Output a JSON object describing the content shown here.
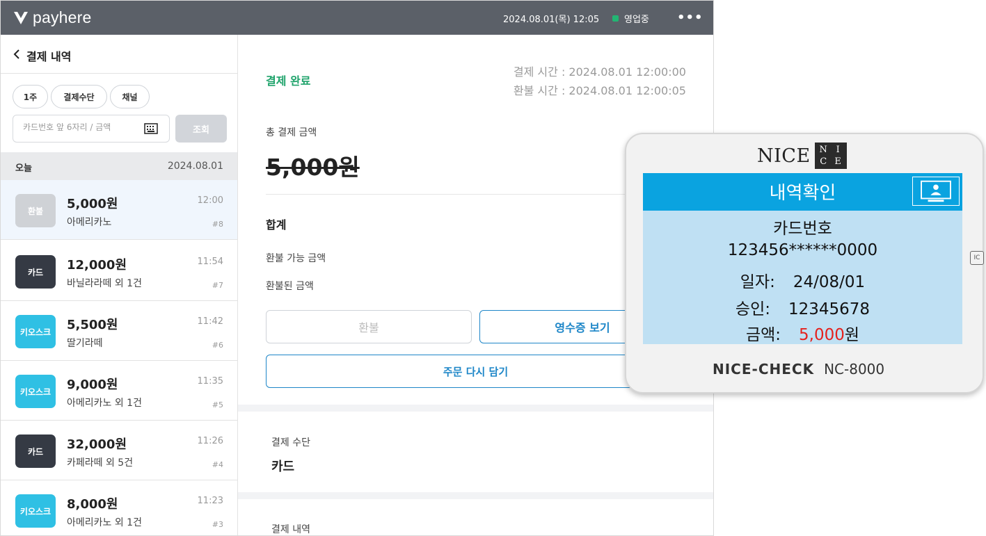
{
  "header": {
    "brand": "payhere",
    "datetime": "2024.08.01(목) 12:05",
    "store_status": "영업중"
  },
  "sidebar": {
    "title": "결제 내역",
    "filters": [
      "1주",
      "결제수단",
      "채널"
    ],
    "search": {
      "placeholder": "카드번호 앞 6자리 / 금액",
      "button": "조회"
    },
    "date_group": {
      "label": "오늘",
      "date": "2024.08.01"
    },
    "transactions": [
      {
        "badge": "환불",
        "amount": "5,000원",
        "item": "아메리카노",
        "time": "12:00",
        "no": "#8"
      },
      {
        "badge": "카드",
        "amount": "12,000원",
        "item": "바닐라라떼 외 1건",
        "time": "11:54",
        "no": "#7"
      },
      {
        "badge": "키오스크",
        "amount": "5,500원",
        "item": "딸기라떼",
        "time": "11:42",
        "no": "#6"
      },
      {
        "badge": "키오스크",
        "amount": "9,000원",
        "item": "아메리카노 외 1건",
        "time": "11:35",
        "no": "#5"
      },
      {
        "badge": "카드",
        "amount": "32,000원",
        "item": "카페라떼 외 5건",
        "time": "11:26",
        "no": "#4"
      },
      {
        "badge": "키오스크",
        "amount": "8,000원",
        "item": "아메리카노 외 1건",
        "time": "11:23",
        "no": "#3"
      }
    ]
  },
  "detail": {
    "status": "결제 완료",
    "paid_time": "결제 시간 : 2024.08.01 12:00:00",
    "refund_time": "환불 시간 : 2024.08.01 12:00:05",
    "total_label": "총 결제 금액",
    "total_amount": "5,000원",
    "sum_label": "합계",
    "refundable_label": "환불 가능 금액",
    "refunded_label": "환불된 금액",
    "refund_button": "환불",
    "receipt_button": "영수증 보기",
    "reorder_button": "주문 다시 담기",
    "method_label": "결제 수단",
    "method_value": "카드",
    "history_label": "결제 내역"
  },
  "terminal": {
    "brand": "NICE",
    "brand_box": [
      "N",
      "I",
      "C",
      "E"
    ],
    "screen_title": "내역확인",
    "card_label": "카드번호",
    "card_number": "123456******0000",
    "date_label": "일자:",
    "date_value": "24/08/01",
    "approval_label": "승인:",
    "approval_value": "12345678",
    "amount_label": "금액:",
    "amount_value": "5,000",
    "amount_unit": "원",
    "model_name": "NICE-CHECK",
    "model_no": "NC-8000",
    "port_label": "IC"
  },
  "colors": {
    "topbar": "#5b6068",
    "status_green": "#1fa36b",
    "accent_blue": "#1d86c8",
    "kiosk_badge": "#2fc0e4",
    "card_badge": "#353a44",
    "refund_badge": "#cfd2d6",
    "terminal_header": "#0aa3e0",
    "terminal_amount": "#e5211d"
  }
}
